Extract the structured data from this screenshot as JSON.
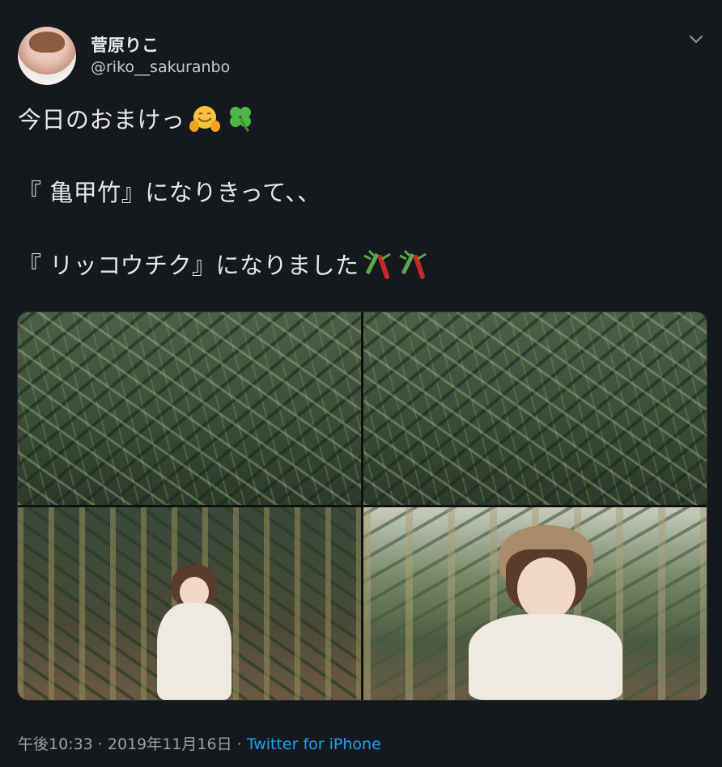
{
  "author": {
    "display_name": "菅原りこ",
    "handle": "@riko__sakuranbo"
  },
  "tweet": {
    "lines": [
      "今日のおまけっ",
      "『 亀甲竹』になりきって、、",
      "『 リッコウチク』になりました"
    ]
  },
  "icons": {
    "line1": [
      "hugging-face-emoji",
      "four-leaf-clover-emoji"
    ],
    "line3": [
      "bamboo-emoji",
      "bamboo-emoji"
    ],
    "menu": "chevron-down-icon"
  },
  "meta": {
    "time": "午後10:33",
    "separator1": " · ",
    "date": "2019年11月16日",
    "separator2": " · ",
    "source": "Twitter for iPhone"
  },
  "colors": {
    "background": "#15181c",
    "link": "#1da1f2",
    "text": "#e6e6e6",
    "muted": "#9aa0a6"
  }
}
